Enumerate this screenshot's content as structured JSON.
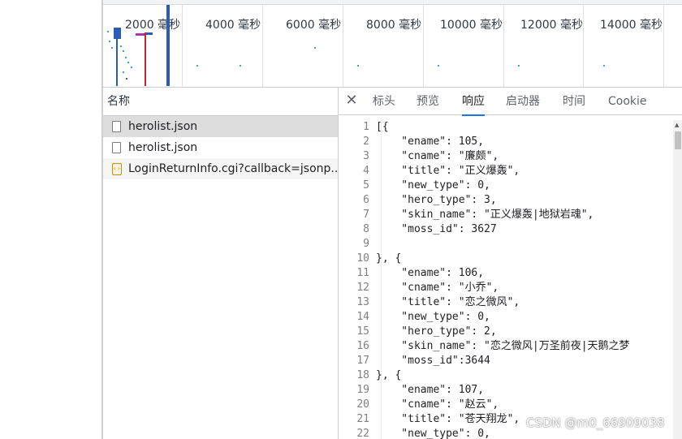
{
  "overview": {
    "ticks": [
      "2000 毫秒",
      "4000 毫秒",
      "6000 毫秒",
      "8000 毫秒",
      "10000 毫秒",
      "12000 毫秒",
      "14000 毫秒"
    ]
  },
  "name_panel": {
    "header": "名称",
    "requests": [
      {
        "name": "herolist.json",
        "icon": "file-icon",
        "state": "selected"
      },
      {
        "name": "herolist.json",
        "icon": "file-icon",
        "state": ""
      },
      {
        "name": "LoginReturnInfo.cgi?callback=jsonp...",
        "icon": "script-icon",
        "state": "alt"
      }
    ]
  },
  "detail_panel": {
    "close_icon": "close-icon",
    "tabs": [
      "标头",
      "预览",
      "响应",
      "启动器",
      "时间",
      "Cookie"
    ],
    "active_tab": "响应",
    "code_lines": [
      {
        "n": "1",
        "text": "[{"
      },
      {
        "n": "2",
        "text": "    \"ename\": 105,"
      },
      {
        "n": "3",
        "text": "    \"cname\": \"廉颇\","
      },
      {
        "n": "4",
        "text": "    \"title\": \"正义爆轰\","
      },
      {
        "n": "5",
        "text": "    \"new_type\": 0,"
      },
      {
        "n": "6",
        "text": "    \"hero_type\": 3,"
      },
      {
        "n": "7",
        "text": "    \"skin_name\": \"正义爆轰|地狱岩魂\","
      },
      {
        "n": "8",
        "text": "    \"moss_id\": 3627"
      },
      {
        "n": "9",
        "text": ""
      },
      {
        "n": "10",
        "text": "}, {"
      },
      {
        "n": "11",
        "text": "    \"ename\": 106,"
      },
      {
        "n": "12",
        "text": "    \"cname\": \"小乔\","
      },
      {
        "n": "13",
        "text": "    \"title\": \"恋之微风\","
      },
      {
        "n": "14",
        "text": "    \"new_type\": 0,"
      },
      {
        "n": "15",
        "text": "    \"hero_type\": 2,"
      },
      {
        "n": "16",
        "text": "    \"skin_name\": \"恋之微风|万圣前夜|天鹅之梦"
      },
      {
        "n": "17",
        "text": "    \"moss_id\":3644"
      },
      {
        "n": "18",
        "text": "}, {"
      },
      {
        "n": "19",
        "text": "    \"ename\": 107,"
      },
      {
        "n": "20",
        "text": "    \"cname\": \"赵云\","
      },
      {
        "n": "21",
        "text": "    \"title\": \"苍天翔龙\","
      },
      {
        "n": "22",
        "text": "    \"new_type\": 0,"
      }
    ]
  },
  "watermark": "CSDN @m0_66909038",
  "colors": {
    "accent": "#1a73e8",
    "selected_row": "#dddddd",
    "timeline_blue": "#2b5cb8",
    "timeline_red": "#c62828"
  }
}
